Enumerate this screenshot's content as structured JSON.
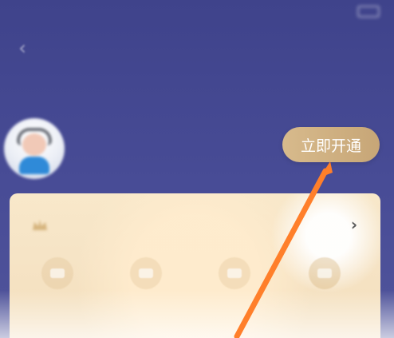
{
  "status_bar": {
    "time": "",
    "signal": "",
    "battery": ""
  },
  "header": {
    "back_icon": "chevron-left-icon",
    "title": ""
  },
  "user": {
    "name": "",
    "subtitle": "",
    "avatar_icon": "avatar"
  },
  "actions": {
    "open_now": "立即开通"
  },
  "vip_card": {
    "title": "",
    "crown_icon": "crown-icon",
    "chevron_icon": "chevron-right-icon",
    "benefits": [
      {
        "label": "",
        "icon": "benefit-icon"
      },
      {
        "label": "",
        "icon": "benefit-icon"
      },
      {
        "label": "",
        "icon": "benefit-icon"
      },
      {
        "label": "",
        "icon": "card-icon"
      }
    ]
  },
  "annotations": {
    "arrow_color": "#ff7f2a"
  },
  "colors": {
    "background": "#43488f",
    "button_gold": "#cfb081",
    "card_cream": "#f6e4c6"
  }
}
